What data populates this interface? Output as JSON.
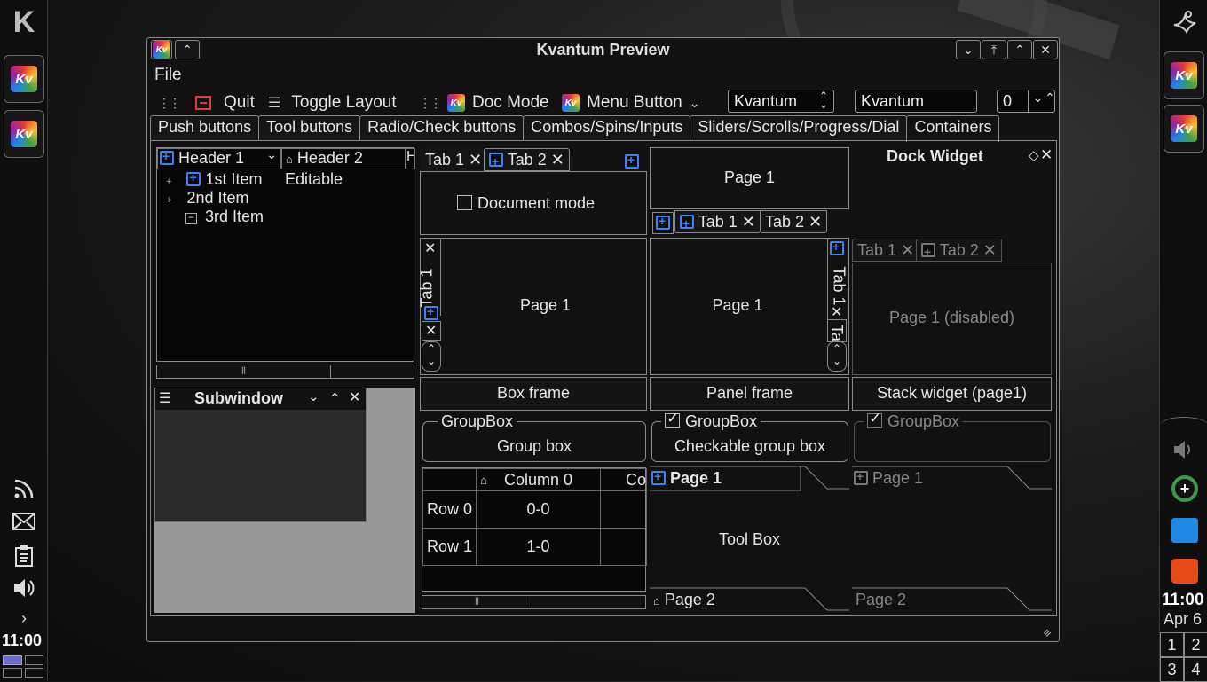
{
  "window": {
    "title": "Kvantum Preview",
    "logo_text": "Kv"
  },
  "menubar": {
    "file": "File"
  },
  "toolbar": {
    "quit": "Quit",
    "toggle_layout": "Toggle Layout",
    "doc_mode": "Doc Mode",
    "menu_button": "Menu Button",
    "combo_value": "Kvantum",
    "line_edit_value": "Kvantum",
    "spin_value": "0"
  },
  "main_tabs": [
    {
      "label": "Push buttons"
    },
    {
      "label": "Tool buttons"
    },
    {
      "label": "Radio/Check buttons"
    },
    {
      "label": "Combos/Spins/Inputs"
    },
    {
      "label": "Sliders/Scrolls/Progress/Dial"
    },
    {
      "label": "Containers"
    }
  ],
  "tree": {
    "headers": [
      "Header 1",
      "Header 2",
      "H"
    ],
    "items": [
      {
        "label": "1st Item",
        "col2": "Editable"
      },
      {
        "label": "2nd Item",
        "col2": ""
      },
      {
        "label": "3rd Item",
        "col2": ""
      }
    ]
  },
  "subwindow": {
    "title": "Subwindow"
  },
  "tabwidgets": {
    "tab1": "Tab 1",
    "tab2": "Tab 2",
    "tab_partial": "Ta",
    "page1": "Page 1",
    "page1_disabled": "Page 1 (disabled)",
    "document_mode": "Document mode"
  },
  "dock": {
    "title": "Dock Widget"
  },
  "frames": {
    "box": "Box frame",
    "panel": "Panel frame",
    "stack": "Stack widget (page1)"
  },
  "groupboxes": {
    "title": "GroupBox",
    "group_box": "Group box",
    "checkable": "Checkable group box"
  },
  "table": {
    "col0": "Column 0",
    "col1_partial": "Co",
    "rows": [
      {
        "header": "Row 0",
        "value": "0-0"
      },
      {
        "header": "Row 1",
        "value": "1-0"
      }
    ]
  },
  "toolbox": {
    "page1": "Page 1",
    "page2": "Page 2",
    "content": "Tool Box"
  },
  "clock": {
    "left": "11:00",
    "right": "11:00",
    "date": "Apr 6"
  },
  "pager": [
    "1",
    "2",
    "3",
    "4"
  ]
}
